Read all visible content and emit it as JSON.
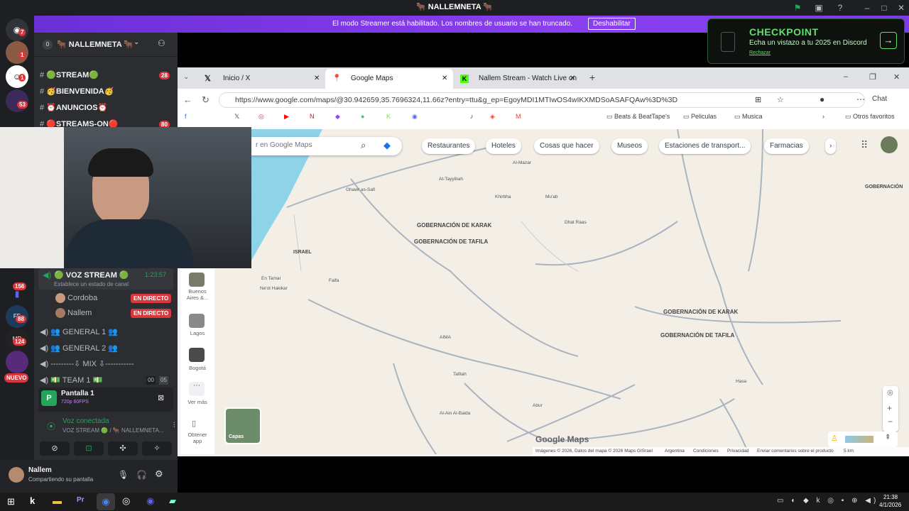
{
  "window_title": "🐂 NALLEMNETA 🐂",
  "streamer_banner": {
    "message": "El modo Streamer está habilitado. Los nombres de usuario se han truncado.",
    "button": "Deshabilitar"
  },
  "checkpoint": {
    "title": "CHECKPOINT",
    "subtitle": "Echa un vistazo a tu 2025 en Discord",
    "dismiss": "Rechazar"
  },
  "server": {
    "name": "🐂 NALLEMNETA 🐂",
    "count": "0"
  },
  "server_badges": [
    "7",
    "1",
    "1",
    "53",
    "156",
    "88",
    "124"
  ],
  "new_badge": "NUEVO",
  "channels": [
    {
      "name": "🟢STREAM🟢",
      "badge": "28"
    },
    {
      "name": "🥳BIENVENIDA🥳",
      "badge": ""
    },
    {
      "name": "⏰ANUNCIOS⏰",
      "badge": ""
    },
    {
      "name": "🔴STREAMS-ON🔴",
      "badge": "80"
    }
  ],
  "voice": {
    "channel": "🟢 VOZ STREAM 🟢",
    "timer": "1:23:57",
    "status": "Establece un estado de canal",
    "members": [
      {
        "name": "Cordoba",
        "tag": "EN DIRECTO"
      },
      {
        "name": "Nallem",
        "tag": "EN DIRECTO"
      }
    ],
    "others": [
      "👥 GENERAL 1 👥",
      "👥 GENERAL 2 👥",
      "---------⇩ MIX ⇩-----------",
      "💵 TEAM 1 💵"
    ],
    "team_counts": [
      "00",
      "05"
    ]
  },
  "screen_share": {
    "title": "Pantalla 1",
    "quality": "720p 60FPS"
  },
  "connection": {
    "status": "Voz conectada",
    "channel": "VOZ STREAM 🟢 / 🐂 NALLEMNETA..."
  },
  "user": {
    "name": "Nallem",
    "status": "Compartiendo su pantalla"
  },
  "browser": {
    "tabs": [
      {
        "label": "Inicio / X"
      },
      {
        "label": "Google Maps"
      },
      {
        "label": "Nallem Stream - Watch Live on Ki..."
      }
    ],
    "url": "https://www.google.com/maps/@30.942659,35.7696324,11.66z?entry=ttu&g_ep=EgoyMDI1MTIwOS4wIKXMDSoASAFQAw%3D%3D",
    "chat_label": "Chat",
    "bookmarks": [
      "Beats & BeatTape's",
      "Peliculas",
      "Musica",
      "Otros favoritos"
    ]
  },
  "maps": {
    "search_placeholder": "r en Google Maps",
    "chips": [
      "Restaurantes",
      "Hoteles",
      "Cosas que hacer",
      "Museos",
      "Estaciones de transport...",
      "Farmacias"
    ],
    "side": [
      "Buenos Aires &...",
      "Lagos",
      "Bogotá",
      "Ver más",
      "Obtener app"
    ],
    "layers": "Capas",
    "logo": "Google Maps",
    "footer": [
      "Imágenes © 2026, Datos del mapa © 2026 Maps GISrael",
      "Argentina",
      "Condiciones",
      "Privacidad",
      "Enviar comentarios sobre el producto",
      "5 km"
    ],
    "regions": [
      "GOBERNACIÓN DE KARAK",
      "GOBERNACIÓN DE TAFILA",
      "GOBERNACIÓN DE KARAK",
      "GOBERNACIÓN DE TAFILA",
      "ISRAEL",
      "GOBERNACIÓN"
    ],
    "towns": [
      "Al-Mazar",
      "At-Tayyibah",
      "Ghawr as-Safi",
      "Khirbha",
      "Mu'ab",
      "Dhat Raas",
      "En Tamar",
      "Ne'ot Hakikar",
      "Faifa",
      "AIMA",
      "Tafilah",
      "Al-Ain Al-Baida",
      "Abur",
      "Hasa"
    ]
  },
  "clock": {
    "time": "21:38",
    "date": "4/1/2026"
  }
}
